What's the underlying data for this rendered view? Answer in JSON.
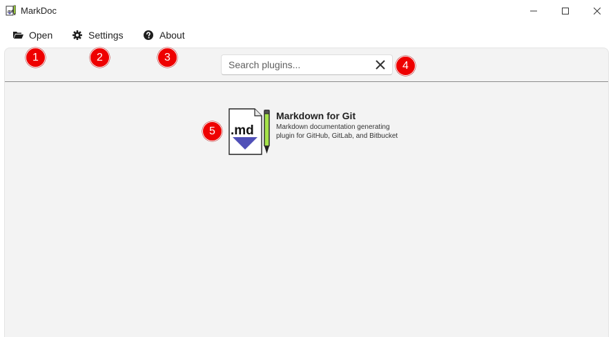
{
  "window": {
    "title": "MarkDoc",
    "controls": {
      "minimize": "minimize-icon",
      "maximize": "maximize-icon",
      "close": "close-icon"
    }
  },
  "menu": {
    "open": {
      "label": "Open",
      "icon": "folder-open-icon"
    },
    "settings": {
      "label": "Settings",
      "icon": "gear-icon"
    },
    "about": {
      "label": "About",
      "icon": "question-circle-icon"
    }
  },
  "search": {
    "placeholder": "Search plugins...",
    "value": "",
    "clear_icon": "clear-icon"
  },
  "annotations": [
    "1",
    "2",
    "3",
    "4",
    "5"
  ],
  "colors": {
    "badge": "#ee0000",
    "content_bg": "#f3f3f3"
  },
  "plugins": [
    {
      "name": "Markdown for Git",
      "description": "Markdown documentation generating plugin for GitHub, GitLab, and Bitbucket",
      "icon_text": ".md",
      "icon": "markdown-file-icon"
    }
  ]
}
